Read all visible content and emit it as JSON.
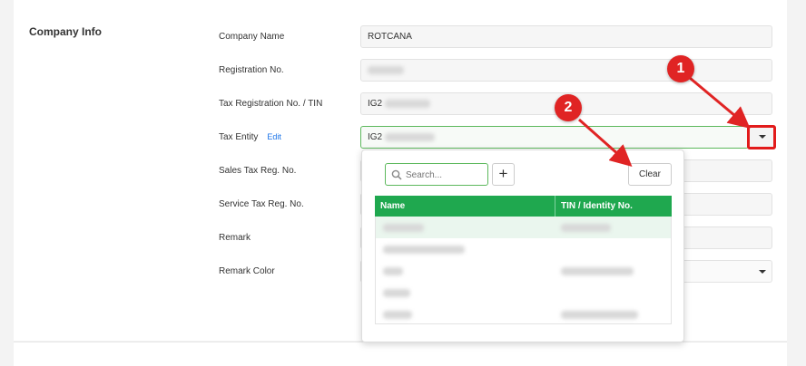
{
  "section": {
    "title": "Company Info"
  },
  "form": {
    "company_name_label": "Company Name",
    "company_name_value": "ROTCANA",
    "registration_label": "Registration No.",
    "tax_reg_label": "Tax Registration No. / TIN",
    "tax_reg_prefix": "IG2",
    "tax_entity_label": "Tax Entity",
    "tax_entity_edit": "Edit",
    "tax_entity_prefix": "IG2",
    "sales_tax_label": "Sales Tax Reg. No.",
    "service_tax_label": "Service Tax Reg. No.",
    "remark_label": "Remark",
    "remark_color_label": "Remark Color"
  },
  "dropdown": {
    "search_placeholder": "Search...",
    "plus_label": "+",
    "clear_label": "Clear",
    "col_name": "Name",
    "col_tin": "TIN / Identity No."
  },
  "annotations": {
    "marker1": "1",
    "marker2": "2"
  },
  "colors": {
    "accent_green": "#1fa84f",
    "marker_red": "#e02424",
    "link_blue": "#1a73e8"
  }
}
